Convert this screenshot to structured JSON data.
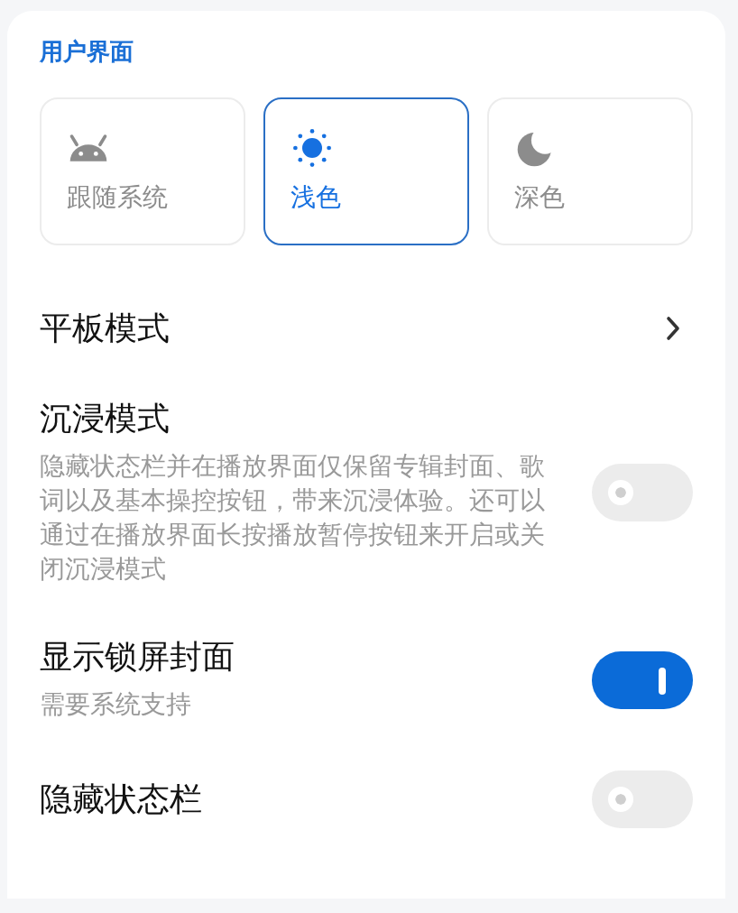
{
  "section_title": "用户界面",
  "themes": [
    {
      "label": "跟随系统",
      "selected": false
    },
    {
      "label": "浅色",
      "selected": true
    },
    {
      "label": "深色",
      "selected": false
    }
  ],
  "settings": [
    {
      "kind": "link",
      "title": "平板模式"
    },
    {
      "kind": "switch",
      "title": "沉浸模式",
      "description": "隐藏状态栏并在播放界面仅保留专辑封面、歌词以及基本操控按钮，带来沉浸体验。还可以通过在播放界面长按播放暂停按钮来开启或关闭沉浸模式",
      "on": false
    },
    {
      "kind": "switch",
      "title": "显示锁屏封面",
      "description": "需要系统支持",
      "on": true
    },
    {
      "kind": "switch",
      "title": "隐藏状态栏",
      "on": false
    }
  ]
}
